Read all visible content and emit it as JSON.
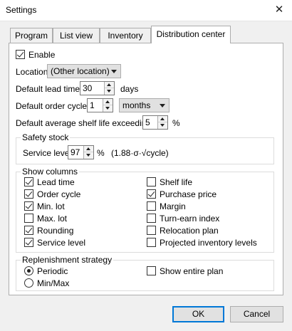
{
  "window": {
    "title": "Settings",
    "close_glyph": "✕"
  },
  "tabs": [
    {
      "label": "Program"
    },
    {
      "label": "List view"
    },
    {
      "label": "Inventory"
    },
    {
      "label": "Distribution center"
    }
  ],
  "enable": {
    "label": "Enable",
    "checked": true
  },
  "location": {
    "label": "Location",
    "value": "(Other location)"
  },
  "lead_time": {
    "label": "Default lead time",
    "value": "30",
    "unit": "days"
  },
  "order_cycle": {
    "label": "Default order cycle",
    "value": "1",
    "unit_value": "months"
  },
  "shelf_life": {
    "label": "Default average shelf life exceeding",
    "value": "5",
    "unit": "%"
  },
  "safety_stock": {
    "title": "Safety stock",
    "service_level_label": "Service level",
    "service_level_value": "97",
    "unit": "%",
    "formula": "(1.88·σ·√cycle)"
  },
  "show_columns": {
    "title": "Show columns",
    "left": [
      {
        "label": "Lead time",
        "checked": true
      },
      {
        "label": "Order cycle",
        "checked": true
      },
      {
        "label": "Min. lot",
        "checked": true
      },
      {
        "label": "Max. lot",
        "checked": false
      },
      {
        "label": "Rounding",
        "checked": true
      },
      {
        "label": "Service level",
        "checked": true
      }
    ],
    "right": [
      {
        "label": "Shelf life",
        "checked": false
      },
      {
        "label": "Purchase price",
        "checked": true
      },
      {
        "label": "Margin",
        "checked": false
      },
      {
        "label": "Turn-earn index",
        "checked": false
      },
      {
        "label": "Relocation plan",
        "checked": false
      },
      {
        "label": "Projected inventory levels",
        "checked": false
      }
    ]
  },
  "replenishment": {
    "title": "Replenishment strategy",
    "periodic": {
      "label": "Periodic",
      "selected": true
    },
    "minmax": {
      "label": "Min/Max",
      "selected": false
    },
    "show_entire_plan": {
      "label": "Show entire plan",
      "checked": false
    }
  },
  "buttons": {
    "ok": "OK",
    "cancel": "Cancel"
  }
}
